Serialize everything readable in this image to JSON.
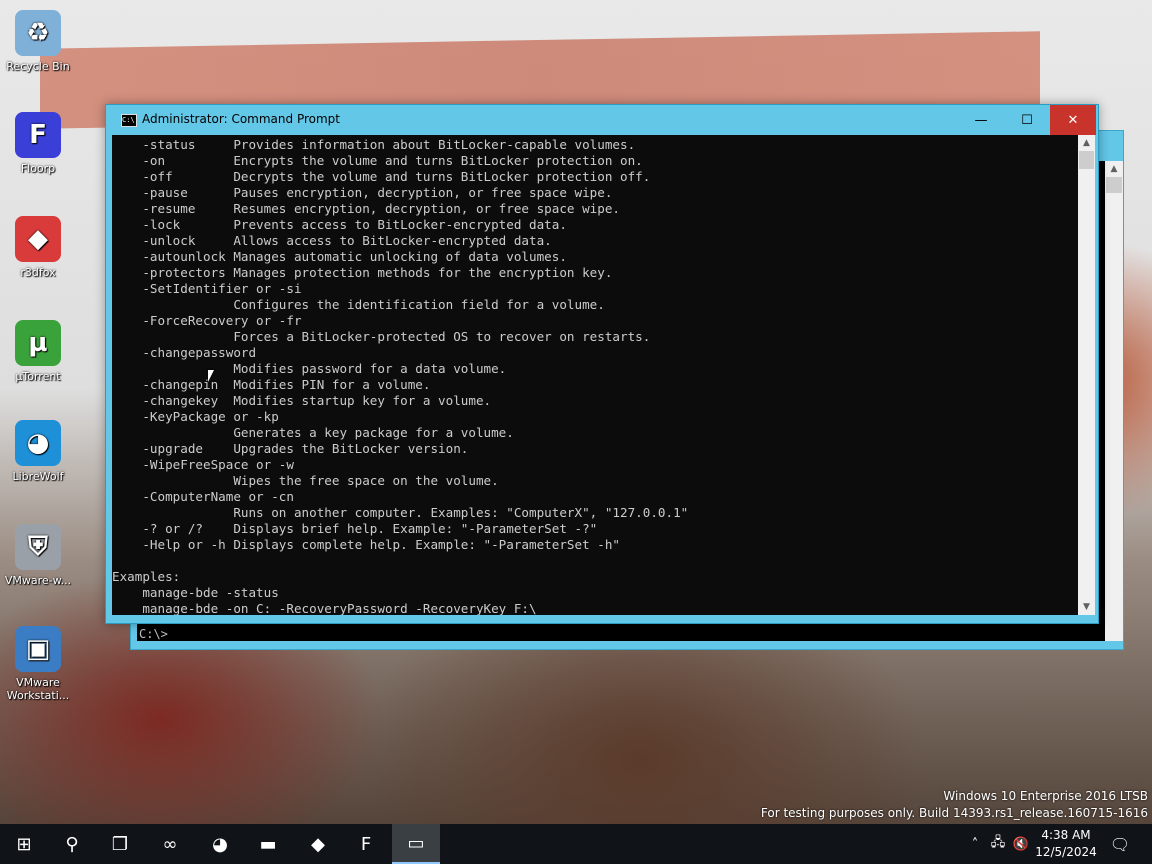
{
  "desktop": {
    "icons": [
      {
        "label": "Recycle Bin",
        "icon": "recycle-bin-icon",
        "color": "#7fb0d8",
        "glyph": "♻"
      },
      {
        "label": "Floorp",
        "icon": "floorp-icon",
        "color": "#3a3fd8",
        "glyph": "F"
      },
      {
        "label": "r3dfox",
        "icon": "r3dfox-icon",
        "color": "#d93a3a",
        "glyph": "◆"
      },
      {
        "label": "µTorrent",
        "icon": "utorrent-icon",
        "color": "#3aa23a",
        "glyph": "µ"
      },
      {
        "label": "LibreWolf",
        "icon": "librewolf-icon",
        "color": "#1e90d8",
        "glyph": "◕"
      },
      {
        "label": "VMware-w...",
        "icon": "vmware-installer-icon",
        "color": "#9aa0a8",
        "glyph": "⛨"
      },
      {
        "label": "VMware Workstati...",
        "icon": "vmware-workstation-icon",
        "color": "#3b7dc4",
        "glyph": "▣"
      }
    ]
  },
  "background_window": {
    "prompt": "C:\\>"
  },
  "window": {
    "title": "Administrator: Command Prompt",
    "app_icon": "C:\\",
    "minimize": "—",
    "maximize": "☐",
    "close": "✕"
  },
  "console": {
    "lines": [
      "    -status     Provides information about BitLocker-capable volumes.",
      "    -on         Encrypts the volume and turns BitLocker protection on.",
      "    -off        Decrypts the volume and turns BitLocker protection off.",
      "    -pause      Pauses encryption, decryption, or free space wipe.",
      "    -resume     Resumes encryption, decryption, or free space wipe.",
      "    -lock       Prevents access to BitLocker-encrypted data.",
      "    -unlock     Allows access to BitLocker-encrypted data.",
      "    -autounlock Manages automatic unlocking of data volumes.",
      "    -protectors Manages protection methods for the encryption key.",
      "    -SetIdentifier or -si",
      "                Configures the identification field for a volume.",
      "    -ForceRecovery or -fr",
      "                Forces a BitLocker-protected OS to recover on restarts.",
      "    -changepassword",
      "                Modifies password for a data volume.",
      "    -changepin  Modifies PIN for a volume.",
      "    -changekey  Modifies startup key for a volume.",
      "    -KeyPackage or -kp",
      "                Generates a key package for a volume.",
      "    -upgrade    Upgrades the BitLocker version.",
      "    -WipeFreeSpace or -w",
      "                Wipes the free space on the volume.",
      "    -ComputerName or -cn",
      "                Runs on another computer. Examples: \"ComputerX\", \"127.0.0.1\"",
      "    -? or /?    Displays brief help. Example: \"-ParameterSet -?\"",
      "    -Help or -h Displays complete help. Example: \"-ParameterSet -h\"",
      "",
      "Examples:",
      "    manage-bde -status",
      "    manage-bde -on C: -RecoveryPassword -RecoveryKey F:\\"
    ]
  },
  "watermark": {
    "line1": "Windows 10 Enterprise 2016 LTSB",
    "line2": "For testing purposes only. Build 14393.rs1_release.160715-1616"
  },
  "taskbar": {
    "items": [
      {
        "name": "start-button",
        "icon": "windows-logo-icon",
        "glyph": "⊞"
      },
      {
        "name": "search-button",
        "icon": "search-icon",
        "glyph": "⚲"
      },
      {
        "name": "task-view-button",
        "icon": "task-view-icon",
        "glyph": "❐"
      },
      {
        "name": "taskbar-app-infinity",
        "icon": "infinity-icon",
        "glyph": "∞"
      },
      {
        "name": "taskbar-app-librewolf",
        "icon": "librewolf-icon",
        "glyph": "◕"
      },
      {
        "name": "taskbar-app-file-explorer",
        "icon": "folder-icon",
        "glyph": "▬"
      },
      {
        "name": "taskbar-app-r3dfox",
        "icon": "r3dfox-icon",
        "glyph": "◆"
      },
      {
        "name": "taskbar-app-floorp",
        "icon": "floorp-icon",
        "glyph": "F"
      },
      {
        "name": "taskbar-app-command-prompt",
        "icon": "command-prompt-icon",
        "glyph": "▭"
      }
    ],
    "time": "4:38 AM",
    "date": "12/5/2024"
  },
  "colors": {
    "window_frame": "#63c7e8",
    "close_button": "#c8332b",
    "console_bg": "#0c0c0c",
    "console_text": "#cccccc",
    "taskbar_bg": "#101418"
  }
}
